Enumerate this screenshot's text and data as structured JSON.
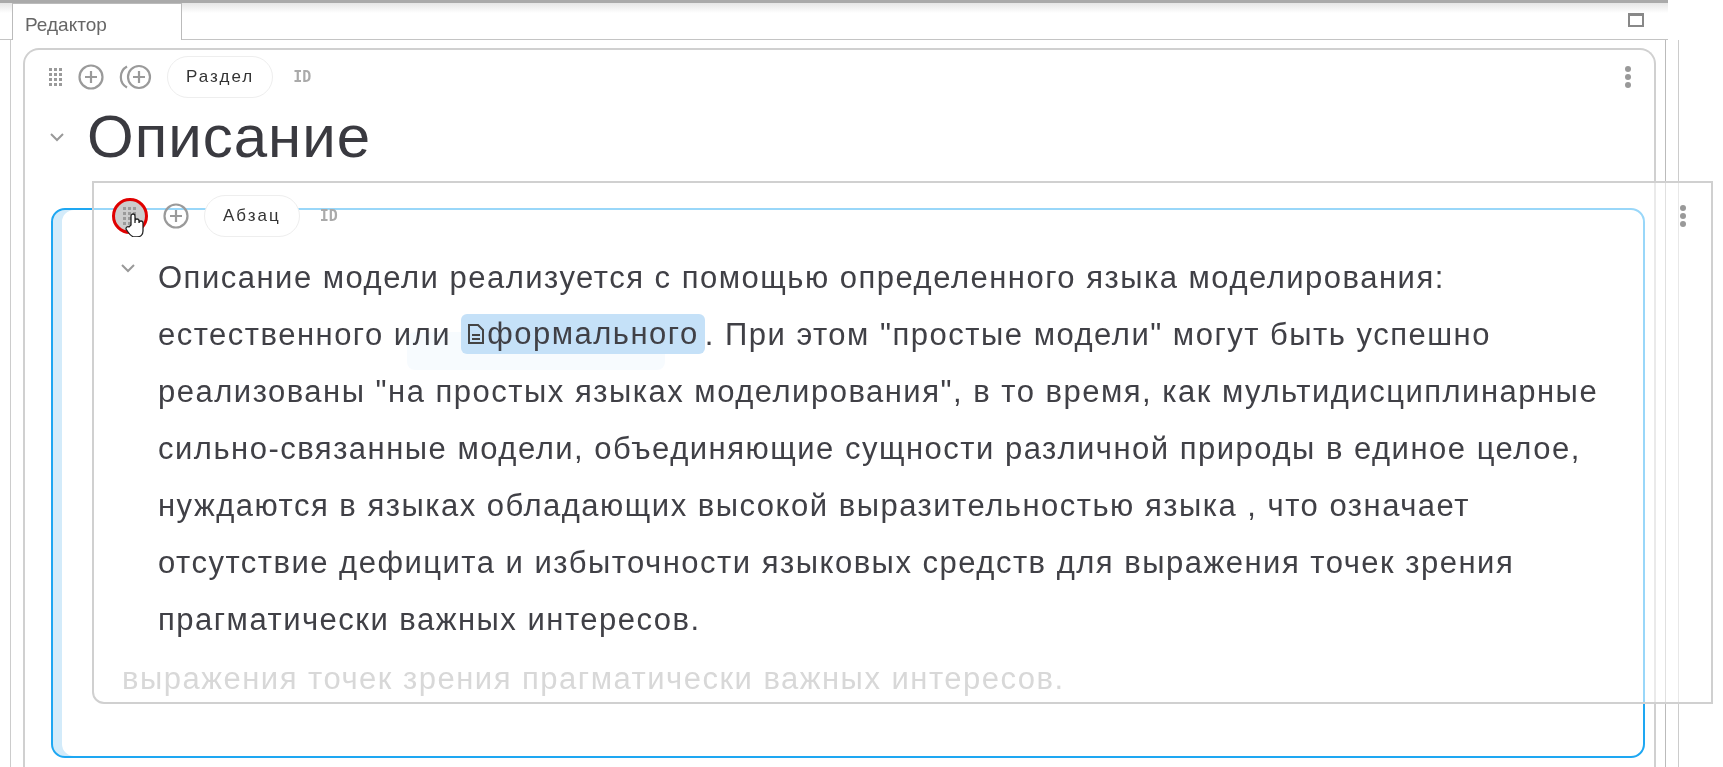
{
  "tabs": [
    {
      "label": "Редактор",
      "selected": true
    }
  ],
  "section": {
    "type_label": "Раздел",
    "id_label": "ID",
    "expanded": true,
    "title": "Описание",
    "paragraph": {
      "last_line": "выражения точек зрения прагматически важных интересов."
    }
  },
  "drag_preview": {
    "type_label": "Абзац",
    "id_label": "ID",
    "expanded": true,
    "text_before": "Описание модели реализуется с помощью определенного языка моделирования:\nестественного или ",
    "link": "формального",
    "text_after": ". При этом \"простые модели\" могут быть успешно\nреализованы \"на простых языках моделирования\", в то время, как мультидисциплинарные\nсильно-связанные модели, объединяющие сущности различной природы в единое целое,\nнуждаются в языках обладающих высокой выразительностью языка , что означает\nотсутствие дефицита и избыточности языковых средств для выражения точек зрения\nпрагматически важных интересов."
  }
}
